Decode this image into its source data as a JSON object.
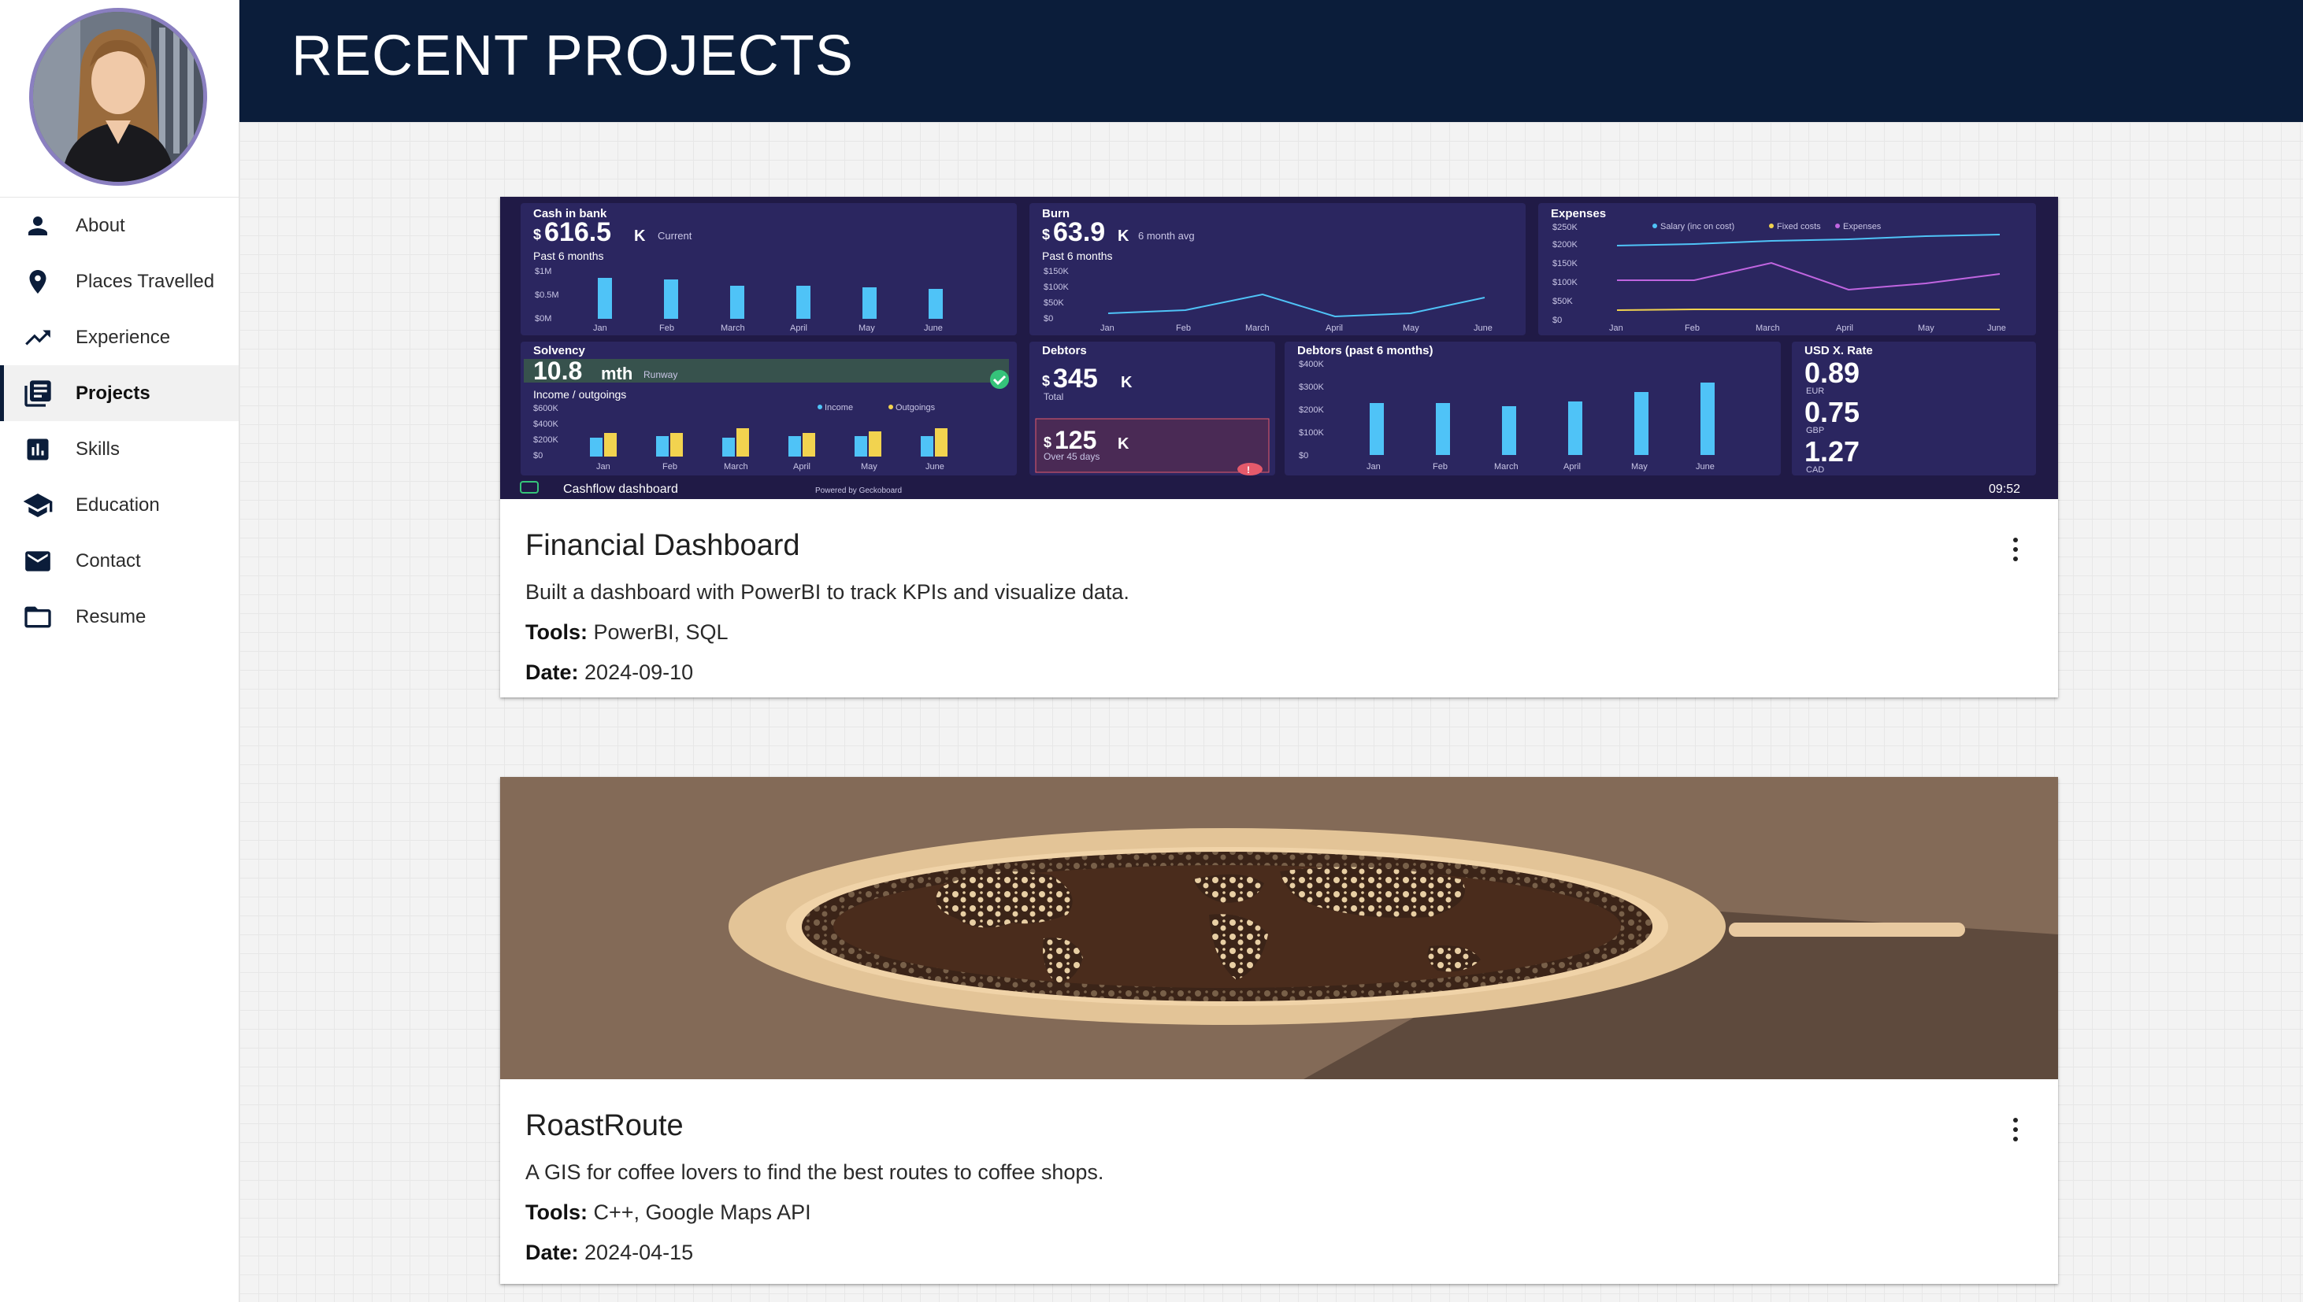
{
  "header": {
    "title": "RECENT PROJECTS"
  },
  "sidebar": {
    "items": [
      {
        "label": "About",
        "icon": "person-icon",
        "active": false
      },
      {
        "label": "Places Travelled",
        "icon": "location-pin-icon",
        "active": false
      },
      {
        "label": "Experience",
        "icon": "trending-up-icon",
        "active": false
      },
      {
        "label": "Projects",
        "icon": "library-books-icon",
        "active": true
      },
      {
        "label": "Skills",
        "icon": "bar-chart-icon",
        "active": false
      },
      {
        "label": "Education",
        "icon": "graduation-cap-icon",
        "active": false
      },
      {
        "label": "Contact",
        "icon": "mail-icon",
        "active": false
      },
      {
        "label": "Resume",
        "icon": "folder-icon",
        "active": false
      }
    ]
  },
  "projects": [
    {
      "title": "Financial Dashboard",
      "description": "Built a dashboard with PowerBI to track KPIs and visualize data.",
      "tools_label": "Tools:",
      "tools": "PowerBI, SQL",
      "date_label": "Date:",
      "date": "2024-09-10",
      "dashboard": {
        "cash_title": "Cash in bank",
        "cash_value": "616.5",
        "cash_unit": "K",
        "cash_note": "Current",
        "past_6_months": "Past 6 months",
        "cash_ticks": [
          "$1M",
          "$0.5M",
          "$0M"
        ],
        "burn_title": "Burn",
        "burn_value": "63.9",
        "burn_unit": "K",
        "burn_note": "6 month avg",
        "burn_ticks": [
          "$150K",
          "$100K",
          "$50K",
          "$0"
        ],
        "expenses_title": "Expenses",
        "expenses_legend": [
          "Salary (inc on cost)",
          "Fixed costs",
          "Expenses"
        ],
        "expenses_ticks": [
          "$250K",
          "$200K",
          "$150K",
          "$100K",
          "$50K",
          "$0"
        ],
        "months": [
          "Jan",
          "Feb",
          "March",
          "April",
          "May",
          "June"
        ],
        "solvency_title": "Solvency",
        "solvency_value": "10.8",
        "solvency_unit": "mth",
        "solvency_note": "Runway",
        "income_title": "Income / outgoings",
        "income_legend": [
          "Income",
          "Outgoings"
        ],
        "income_ticks": [
          "$600K",
          "$400K",
          "$200K",
          "$0"
        ],
        "debtors_title": "Debtors",
        "debtors_value": "345",
        "debtors_unit": "K",
        "debtors_note": "Total",
        "overdue_value": "125",
        "overdue_unit": "K",
        "overdue_note": "Over 45 days",
        "debtors6_title": "Debtors (past 6 months)",
        "debtors6_ticks": [
          "$400K",
          "$300K",
          "$200K",
          "$100K",
          "$0"
        ],
        "fx_title": "USD X. Rate",
        "fx": [
          {
            "value": "0.89",
            "code": "EUR"
          },
          {
            "value": "0.75",
            "code": "GBP"
          },
          {
            "value": "1.27",
            "code": "CAD"
          }
        ],
        "footer_title": "Cashflow dashboard",
        "footer_powered": "Powered by Geckoboard",
        "clock": "09:52"
      }
    },
    {
      "title": "RoastRoute",
      "description": "A GIS for coffee lovers to find the best routes to coffee shops.",
      "tools_label": "Tools:",
      "tools": "C++, Google Maps API",
      "date_label": "Date:",
      "date": "2024-04-15"
    }
  ]
}
